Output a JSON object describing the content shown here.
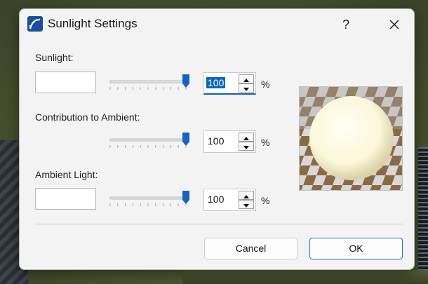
{
  "window": {
    "title": "Sunlight Settings",
    "help_label": "?"
  },
  "sunlight": {
    "label": "Sunlight:",
    "value": "100",
    "slider_level": 1.0,
    "unit": "%"
  },
  "contribution": {
    "label": "Contribution to Ambient:",
    "value": "100",
    "slider_level": 1.0,
    "unit": "%"
  },
  "ambient": {
    "label": "Ambient Light:",
    "value": "100",
    "slider_level": 1.0,
    "unit": "%"
  },
  "buttons": {
    "cancel": "Cancel",
    "ok": "OK"
  },
  "colors": {
    "accent": "#0a64c8",
    "slider_thumb": "#1565c0",
    "sphere": "#fffce6"
  }
}
